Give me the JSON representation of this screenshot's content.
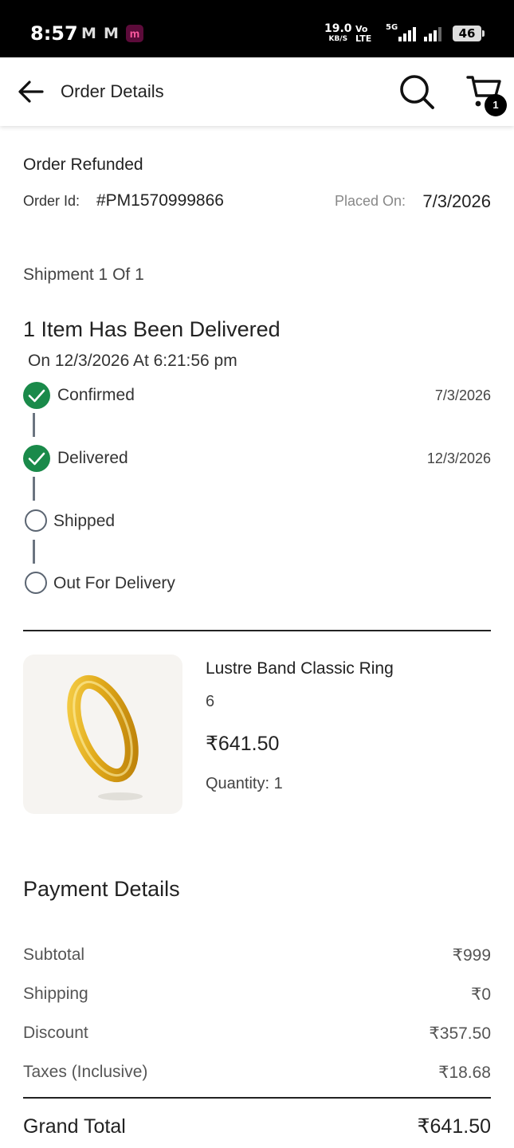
{
  "status_bar": {
    "time": "8:57",
    "notif_1": "M",
    "notif_2": "M",
    "app_icon": "m",
    "speed_value": "19.0",
    "speed_unit": "KB/S",
    "volte_top": "Vo",
    "volte_bottom": "LTE",
    "network": "5G",
    "battery": "46"
  },
  "app_bar": {
    "title": "Order Details",
    "cart_count": "1"
  },
  "order": {
    "status": "Order Refunded",
    "id_label": "Order Id:",
    "id_value": "#PM1570999866",
    "placed_label": "Placed On:",
    "placed_value": "7/3/2026"
  },
  "shipment": {
    "label": "Shipment 1 Of 1",
    "heading": "1 Item Has Been Delivered",
    "delivered_on": "On 12/3/2026 At 6:21:56 pm",
    "steps": [
      {
        "label": "Confirmed",
        "date": "7/3/2026",
        "done": true
      },
      {
        "label": "Delivered",
        "date": "12/3/2026",
        "done": true
      },
      {
        "label": "Shipped",
        "date": "",
        "done": false
      },
      {
        "label": "Out For Delivery",
        "date": "",
        "done": false
      }
    ]
  },
  "product": {
    "name": "Lustre Band Classic Ring",
    "size": "6",
    "price": "₹641.50",
    "quantity": "Quantity: 1"
  },
  "payment": {
    "title": "Payment Details",
    "rows": [
      {
        "label": "Subtotal",
        "value": "₹999"
      },
      {
        "label": "Shipping",
        "value": "₹0"
      },
      {
        "label": "Discount",
        "value": "₹357.50"
      },
      {
        "label": "Taxes (Inclusive)",
        "value": "₹18.68"
      }
    ],
    "grand_total_label": "Grand Total",
    "grand_total_value": "₹641.50"
  },
  "colors": {
    "check_green": "#1a8a4a",
    "pending_ring": "#5b6572"
  }
}
